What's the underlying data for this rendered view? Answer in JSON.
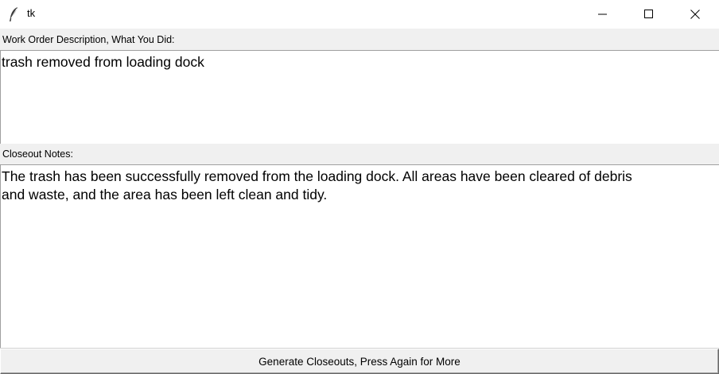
{
  "window": {
    "title": "tk",
    "icon": "feather-icon"
  },
  "controls": {
    "minimize_icon": "minimize-icon",
    "maximize_icon": "maximize-icon",
    "close_icon": "close-icon"
  },
  "form": {
    "description_label": "Work Order Description, What You Did:",
    "description_value": "trash removed from loading dock",
    "notes_label": "Closeout Notes:",
    "notes_value": "The trash has been successfully removed from the loading dock. All areas have been cleared of debris\nand waste, and the area has been left clean and tidy."
  },
  "actions": {
    "generate_label": "Generate Closeouts, Press Again for More"
  }
}
